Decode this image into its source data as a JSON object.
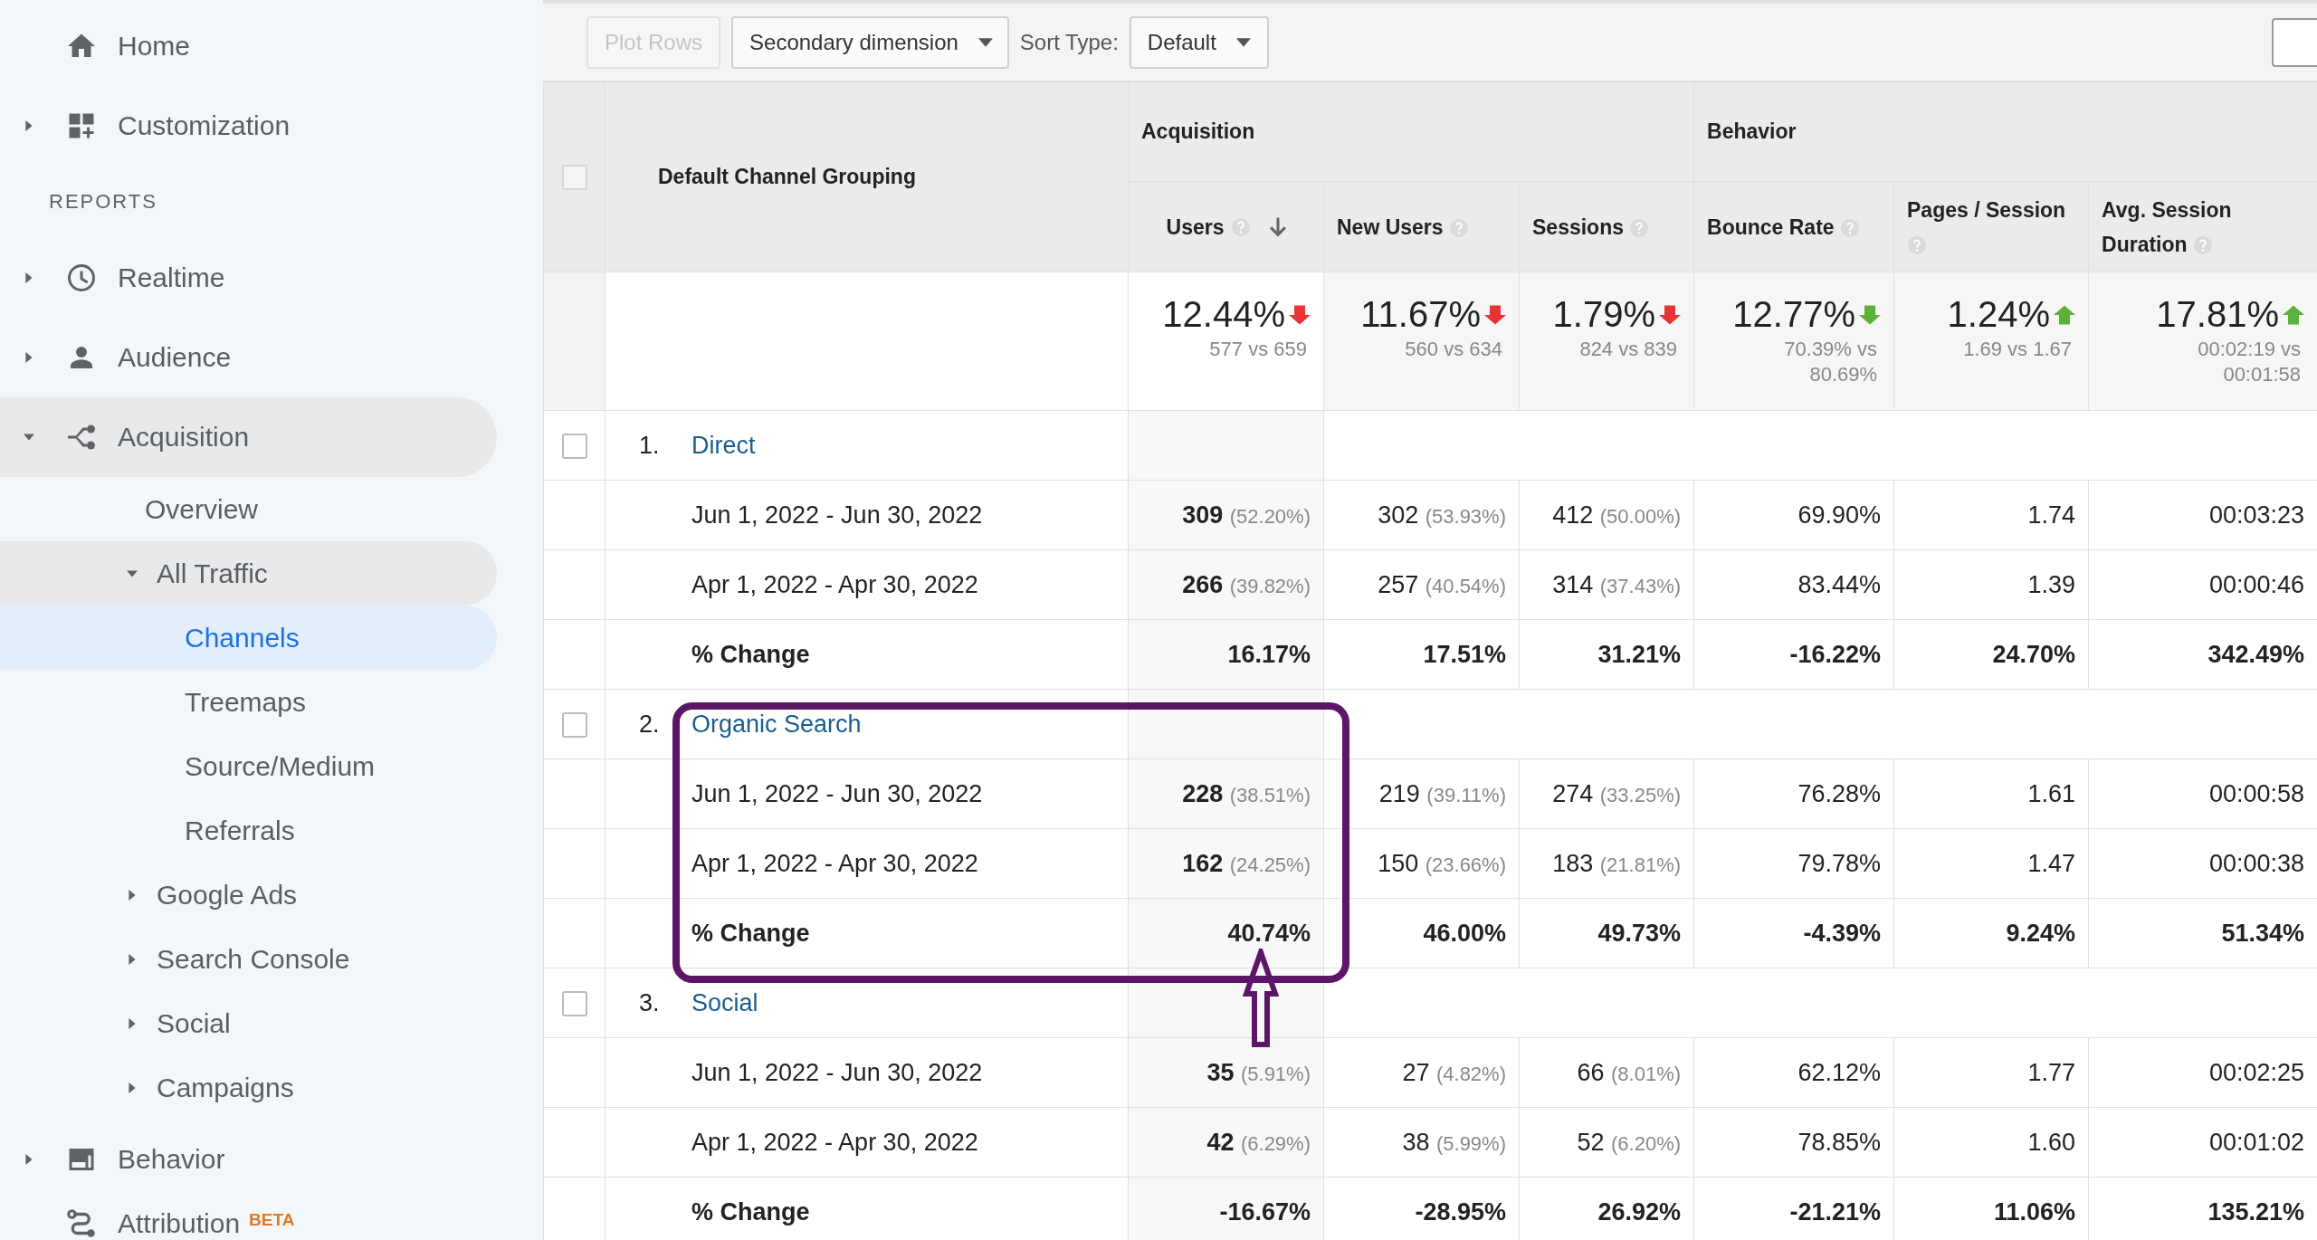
{
  "sidebar": {
    "top_items": [
      {
        "label": "Home",
        "kind": "link",
        "selected": false
      },
      {
        "label": "Customization",
        "kind": "group",
        "expanded": false
      }
    ],
    "section_label": "REPORTS",
    "report_items": [
      {
        "label": "Realtime",
        "kind": "group",
        "expanded": false
      },
      {
        "label": "Audience",
        "kind": "group",
        "expanded": false
      },
      {
        "label": "Acquisition",
        "kind": "group",
        "expanded": true,
        "children": [
          {
            "label": "Overview",
            "kind": "link",
            "selected": false
          },
          {
            "label": "All Traffic",
            "kind": "group",
            "expanded": true,
            "children": [
              {
                "label": "Channels",
                "kind": "link",
                "selected": true
              },
              {
                "label": "Treemaps",
                "kind": "link",
                "selected": false
              },
              {
                "label": "Source/Medium",
                "kind": "link",
                "selected": false
              },
              {
                "label": "Referrals",
                "kind": "link",
                "selected": false
              }
            ]
          },
          {
            "label": "Google Ads",
            "kind": "group",
            "expanded": false
          },
          {
            "label": "Search Console",
            "kind": "group",
            "expanded": false
          },
          {
            "label": "Social",
            "kind": "group",
            "expanded": false
          },
          {
            "label": "Campaigns",
            "kind": "group",
            "expanded": false
          }
        ]
      },
      {
        "label": "Behavior",
        "kind": "group",
        "expanded": false
      },
      {
        "label": "Attribution",
        "kind": "link",
        "selected": false,
        "badge": "BETA"
      }
    ]
  },
  "toolbar": {
    "plot_rows": {
      "label": "Plot Rows",
      "disabled": true
    },
    "secondary_dimension": "Secondary dimension",
    "sort_label": "Sort Type:",
    "sort_value": "Default"
  },
  "table": {
    "dimension_header": "Default Channel Grouping",
    "header_checked": false,
    "column_groups": [
      {
        "label": "Acquisition",
        "columns": [
          {
            "label": "Users",
            "sorted": true
          },
          {
            "label": "New Users",
            "sorted": false
          },
          {
            "label": "Sessions",
            "sorted": false
          }
        ]
      },
      {
        "label": "Behavior",
        "columns": [
          {
            "label": "Bounce Rate",
            "sorted": false
          },
          {
            "label": "Pages / Session",
            "sorted": false
          },
          {
            "label": "Avg. Session Duration",
            "sorted": false
          }
        ]
      }
    ],
    "totals": [
      {
        "value": "12.44%",
        "kind": "down",
        "good": false,
        "comparison": "577 vs 659"
      },
      {
        "value": "11.67%",
        "kind": "down",
        "good": false,
        "comparison": "560 vs 634"
      },
      {
        "value": "1.79%",
        "kind": "down",
        "good": false,
        "comparison": "824 vs 839"
      },
      {
        "value": "12.77%",
        "kind": "down",
        "good": true,
        "comparison": "70.39% vs 80.69%"
      },
      {
        "value": "1.24%",
        "kind": "up",
        "good": true,
        "comparison": "1.69 vs 1.67"
      },
      {
        "value": "17.81%",
        "kind": "up",
        "good": true,
        "comparison": "00:02:19 vs 00:01:58"
      }
    ],
    "channel_groups": [
      {
        "index": "1.",
        "name": "Direct",
        "checked": false,
        "rows": [
          {
            "kind": "period",
            "label": "Jun 1, 2022 - Jun 30, 2022",
            "cells": [
              {
                "value": "309",
                "share": "(52.20%)"
              },
              {
                "value": "302",
                "share": "(53.93%)"
              },
              {
                "value": "412",
                "share": "(50.00%)"
              },
              {
                "value": "69.90%"
              },
              {
                "value": "1.74"
              },
              {
                "value": "00:03:23"
              }
            ]
          },
          {
            "kind": "period",
            "label": "Apr 1, 2022 - Apr 30, 2022",
            "cells": [
              {
                "value": "266",
                "share": "(39.82%)"
              },
              {
                "value": "257",
                "share": "(40.54%)"
              },
              {
                "value": "314",
                "share": "(37.43%)"
              },
              {
                "value": "83.44%"
              },
              {
                "value": "1.39"
              },
              {
                "value": "00:00:46"
              }
            ]
          },
          {
            "kind": "change",
            "label": "% Change",
            "cells": [
              {
                "value": "16.17%"
              },
              {
                "value": "17.51%"
              },
              {
                "value": "31.21%"
              },
              {
                "value": "-16.22%"
              },
              {
                "value": "24.70%"
              },
              {
                "value": "342.49%"
              }
            ]
          }
        ]
      },
      {
        "index": "2.",
        "name": "Organic Search",
        "checked": false,
        "rows": [
          {
            "kind": "period",
            "label": "Jun 1, 2022 - Jun 30, 2022",
            "cells": [
              {
                "value": "228",
                "share": "(38.51%)"
              },
              {
                "value": "219",
                "share": "(39.11%)"
              },
              {
                "value": "274",
                "share": "(33.25%)"
              },
              {
                "value": "76.28%"
              },
              {
                "value": "1.61"
              },
              {
                "value": "00:00:58"
              }
            ]
          },
          {
            "kind": "period",
            "label": "Apr 1, 2022 - Apr 30, 2022",
            "cells": [
              {
                "value": "162",
                "share": "(24.25%)"
              },
              {
                "value": "150",
                "share": "(23.66%)"
              },
              {
                "value": "183",
                "share": "(21.81%)"
              },
              {
                "value": "79.78%"
              },
              {
                "value": "1.47"
              },
              {
                "value": "00:00:38"
              }
            ]
          },
          {
            "kind": "change",
            "label": "% Change",
            "cells": [
              {
                "value": "40.74%"
              },
              {
                "value": "46.00%"
              },
              {
                "value": "49.73%"
              },
              {
                "value": "-4.39%"
              },
              {
                "value": "9.24%"
              },
              {
                "value": "51.34%"
              }
            ]
          }
        ]
      },
      {
        "index": "3.",
        "name": "Social",
        "checked": false,
        "rows": [
          {
            "kind": "period",
            "label": "Jun 1, 2022 - Jun 30, 2022",
            "cells": [
              {
                "value": "35",
                "share": "(5.91%)"
              },
              {
                "value": "27",
                "share": "(4.82%)"
              },
              {
                "value": "66",
                "share": "(8.01%)"
              },
              {
                "value": "62.12%"
              },
              {
                "value": "1.77"
              },
              {
                "value": "00:02:25"
              }
            ]
          },
          {
            "kind": "period",
            "label": "Apr 1, 2022 - Apr 30, 2022",
            "cells": [
              {
                "value": "42",
                "share": "(6.29%)"
              },
              {
                "value": "38",
                "share": "(5.99%)"
              },
              {
                "value": "52",
                "share": "(6.20%)"
              },
              {
                "value": "78.85%"
              },
              {
                "value": "1.60"
              },
              {
                "value": "00:01:02"
              }
            ]
          },
          {
            "kind": "change",
            "label": "% Change",
            "cells": [
              {
                "value": "-16.67%"
              },
              {
                "value": "-28.95%"
              },
              {
                "value": "26.92%"
              },
              {
                "value": "-21.21%"
              },
              {
                "value": "11.06%"
              },
              {
                "value": "135.21%"
              }
            ]
          }
        ]
      }
    ]
  }
}
